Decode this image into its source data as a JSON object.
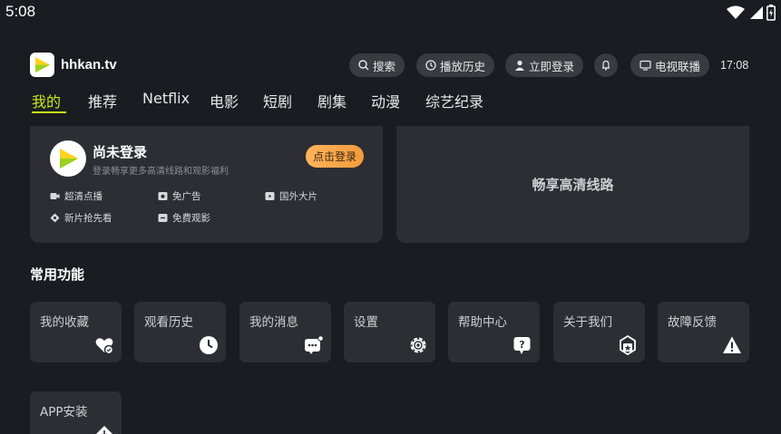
{
  "status_bar": {
    "time": "5:08",
    "icons": [
      "wifi-icon",
      "signal-icon",
      "battery-icon"
    ]
  },
  "header": {
    "brand": "hhkan.tv",
    "search_label": "搜索",
    "history_label": "播放历史",
    "login_label": "立即登录",
    "tv_label": "电视联播",
    "clock": "17:08"
  },
  "tabs": [
    "我的",
    "推荐",
    "Netflix",
    "电影",
    "短剧",
    "剧集",
    "动漫",
    "综艺纪录"
  ],
  "login_card": {
    "title": "尚未登录",
    "subtitle": "登录畅享更多高清线路和观影福利",
    "button": "点击登录",
    "perks": [
      "超清点播",
      "免广告",
      "国外大片",
      "新片抢先看",
      "免费观影"
    ]
  },
  "route_card": {
    "label": "畅享高清线路"
  },
  "section": {
    "title": "常用功能"
  },
  "functions": [
    "我的收藏",
    "观看历史",
    "我的消息",
    "设置",
    "帮助中心",
    "关于我们",
    "故障反馈",
    "APP安装"
  ],
  "colors": {
    "background": "#1b1c21",
    "card": "#2d2e33",
    "accent": "#c8e71b",
    "login_button": "#f29a3d"
  }
}
